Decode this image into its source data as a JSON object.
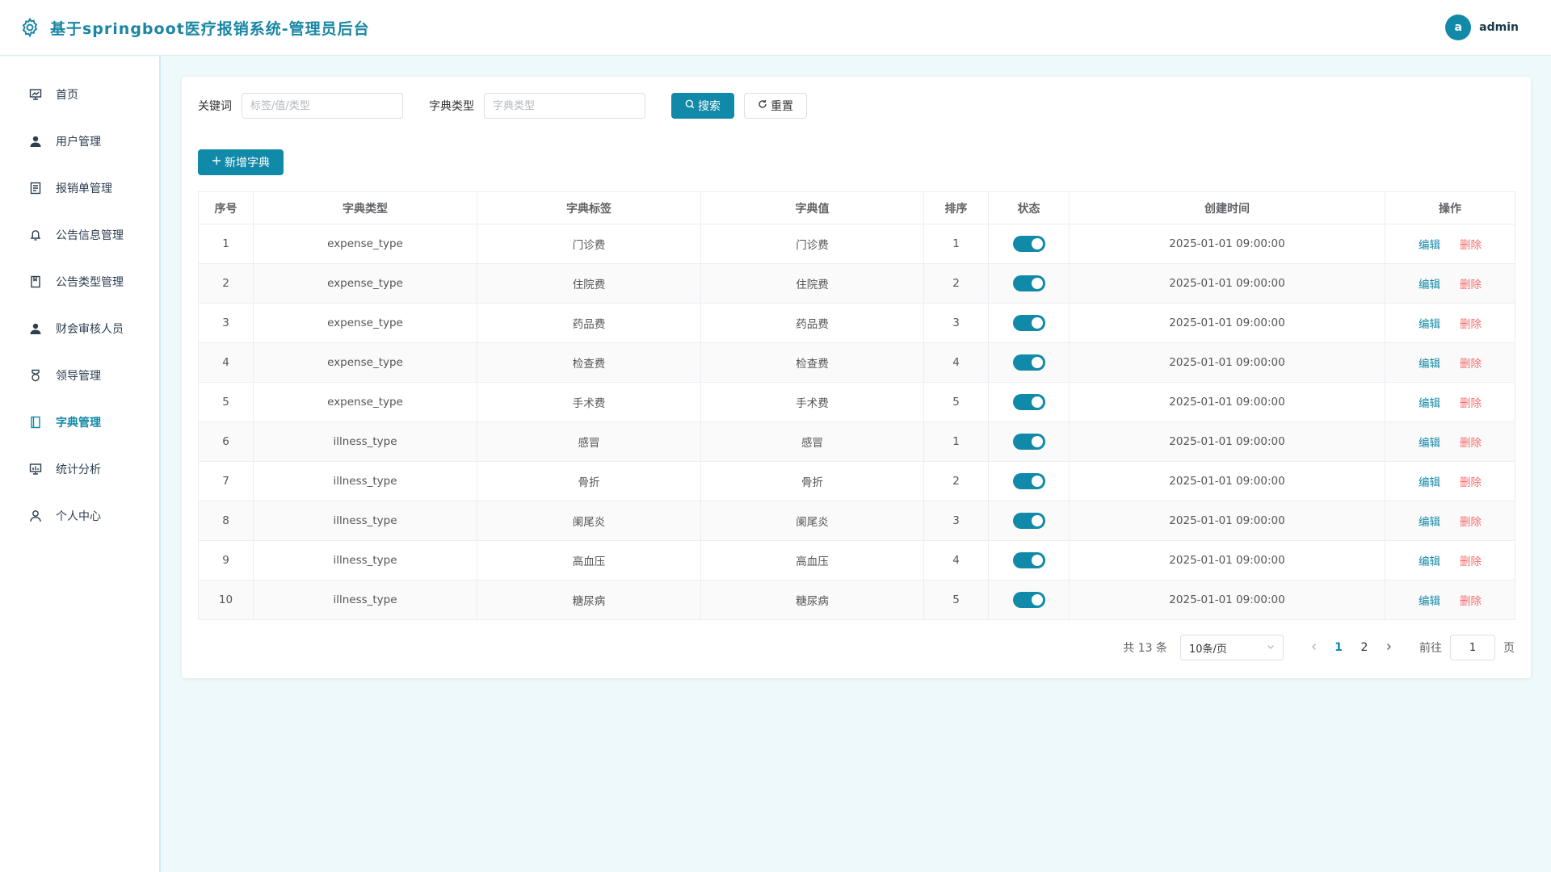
{
  "header": {
    "title": "基于springboot医疗报销系统-管理员后台",
    "avatar_letter": "a",
    "username": "admin"
  },
  "sidebar": {
    "items": [
      {
        "label": "首页",
        "icon": "dashboard-icon"
      },
      {
        "label": "用户管理",
        "icon": "user-icon"
      },
      {
        "label": "报销单管理",
        "icon": "document-icon"
      },
      {
        "label": "公告信息管理",
        "icon": "bell-icon"
      },
      {
        "label": "公告类型管理",
        "icon": "notebook-icon"
      },
      {
        "label": "财会审核人员",
        "icon": "user-icon"
      },
      {
        "label": "领导管理",
        "icon": "medal-icon"
      },
      {
        "label": "字典管理",
        "icon": "book-icon",
        "active": true
      },
      {
        "label": "统计分析",
        "icon": "chart-icon"
      },
      {
        "label": "个人中心",
        "icon": "person-outline-icon"
      }
    ]
  },
  "filters": {
    "keyword_label": "关键词",
    "keyword_placeholder": "标签/值/类型",
    "type_label": "字典类型",
    "type_placeholder": "字典类型",
    "search_label": "搜索",
    "reset_label": "重置"
  },
  "add_button_label": "新增字典",
  "table": {
    "headers": [
      "序号",
      "字典类型",
      "字典标签",
      "字典值",
      "排序",
      "状态",
      "创建时间",
      "操作"
    ],
    "edit_label": "编辑",
    "delete_label": "删除",
    "rows": [
      {
        "index": "1",
        "type": "expense_type",
        "label": "门诊费",
        "value": "门诊费",
        "sort": "1",
        "enabled": true,
        "created": "2025-01-01 09:00:00"
      },
      {
        "index": "2",
        "type": "expense_type",
        "label": "住院费",
        "value": "住院费",
        "sort": "2",
        "enabled": true,
        "created": "2025-01-01 09:00:00"
      },
      {
        "index": "3",
        "type": "expense_type",
        "label": "药品费",
        "value": "药品费",
        "sort": "3",
        "enabled": true,
        "created": "2025-01-01 09:00:00"
      },
      {
        "index": "4",
        "type": "expense_type",
        "label": "检查费",
        "value": "检查费",
        "sort": "4",
        "enabled": true,
        "created": "2025-01-01 09:00:00"
      },
      {
        "index": "5",
        "type": "expense_type",
        "label": "手术费",
        "value": "手术费",
        "sort": "5",
        "enabled": true,
        "created": "2025-01-01 09:00:00"
      },
      {
        "index": "6",
        "type": "illness_type",
        "label": "感冒",
        "value": "感冒",
        "sort": "1",
        "enabled": true,
        "created": "2025-01-01 09:00:00"
      },
      {
        "index": "7",
        "type": "illness_type",
        "label": "骨折",
        "value": "骨折",
        "sort": "2",
        "enabled": true,
        "created": "2025-01-01 09:00:00"
      },
      {
        "index": "8",
        "type": "illness_type",
        "label": "阑尾炎",
        "value": "阑尾炎",
        "sort": "3",
        "enabled": true,
        "created": "2025-01-01 09:00:00"
      },
      {
        "index": "9",
        "type": "illness_type",
        "label": "高血压",
        "value": "高血压",
        "sort": "4",
        "enabled": true,
        "created": "2025-01-01 09:00:00"
      },
      {
        "index": "10",
        "type": "illness_type",
        "label": "糖尿病",
        "value": "糖尿病",
        "sort": "5",
        "enabled": true,
        "created": "2025-01-01 09:00:00"
      }
    ]
  },
  "pagination": {
    "total_text": "共 13 条",
    "page_size": "10条/页",
    "pages": [
      "1",
      "2"
    ],
    "current_page": "1",
    "goto_label": "前往",
    "goto_value": "1",
    "page_suffix": "页"
  },
  "colors": {
    "primary": "#1189a8",
    "danger": "#f56c6c",
    "background": "#eef9fb"
  }
}
